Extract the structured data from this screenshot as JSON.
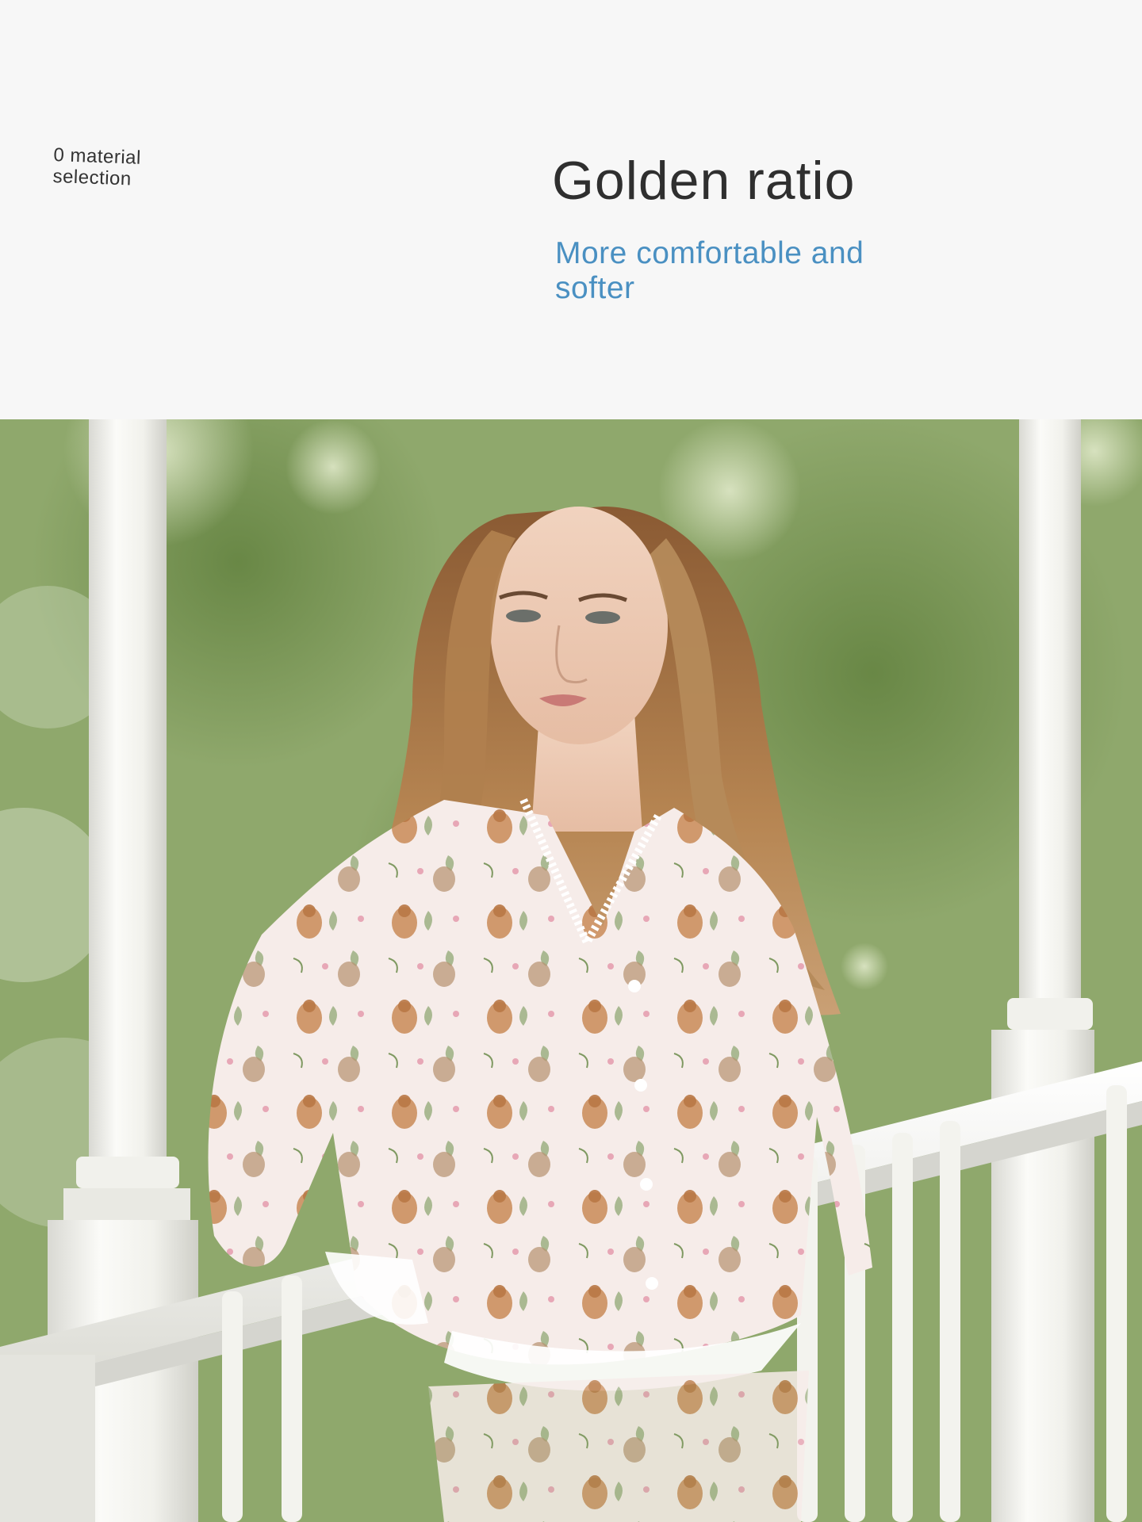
{
  "header": {
    "side_label": "0 material selection",
    "title": "Golden ratio",
    "subtitle": "More comfortable and softer"
  },
  "photo": {
    "subject": "model-in-floral-pajamas",
    "setting": "porch-with-white-columns-and-railing"
  },
  "colors": {
    "background": "#f7f7f7",
    "title": "#2f2f2f",
    "subtitle": "#4a90c2",
    "label": "#333333"
  }
}
